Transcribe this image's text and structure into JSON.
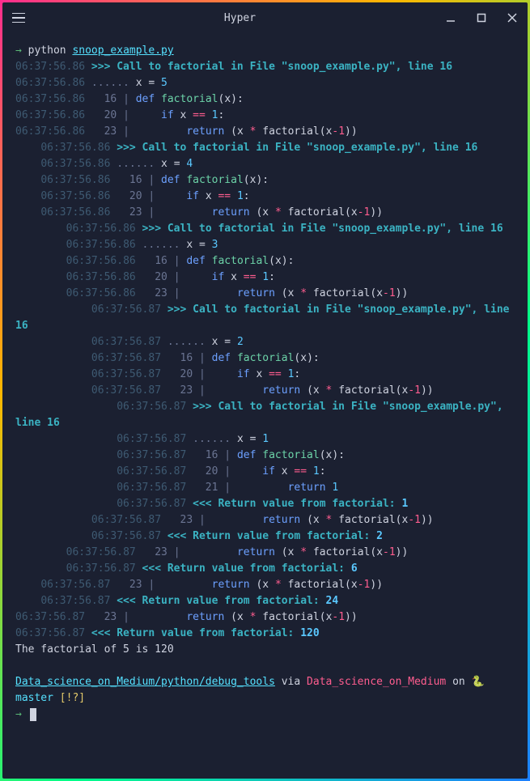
{
  "window": {
    "title": "Hyper"
  },
  "prompt": {
    "arrow": "→",
    "command": "python",
    "file": "snoop_example.py"
  },
  "trace": [
    {
      "indent": 0,
      "ts": "06:37:56.86",
      "kind": "call",
      "msg": "Call to factorial in File \"snoop_example.py\", line 16"
    },
    {
      "indent": 0,
      "ts": "06:37:56.86",
      "kind": "var",
      "name": "x",
      "val": "5"
    },
    {
      "indent": 0,
      "ts": "06:37:56.86",
      "kind": "def",
      "ln": "16"
    },
    {
      "indent": 0,
      "ts": "06:37:56.86",
      "kind": "if",
      "ln": "20"
    },
    {
      "indent": 0,
      "ts": "06:37:56.86",
      "kind": "retx",
      "ln": "23"
    },
    {
      "indent": 1,
      "ts": "06:37:56.86",
      "kind": "call",
      "msg": "Call to factorial in File \"snoop_example.py\", line 16"
    },
    {
      "indent": 1,
      "ts": "06:37:56.86",
      "kind": "var",
      "name": "x",
      "val": "4"
    },
    {
      "indent": 1,
      "ts": "06:37:56.86",
      "kind": "def",
      "ln": "16"
    },
    {
      "indent": 1,
      "ts": "06:37:56.86",
      "kind": "if",
      "ln": "20"
    },
    {
      "indent": 1,
      "ts": "06:37:56.86",
      "kind": "retx",
      "ln": "23"
    },
    {
      "indent": 2,
      "ts": "06:37:56.86",
      "kind": "call",
      "msg": "Call to factorial in File \"snoop_example.py\", line 16"
    },
    {
      "indent": 2,
      "ts": "06:37:56.86",
      "kind": "var",
      "name": "x",
      "val": "3"
    },
    {
      "indent": 2,
      "ts": "06:37:56.86",
      "kind": "def",
      "ln": "16"
    },
    {
      "indent": 2,
      "ts": "06:37:56.86",
      "kind": "if",
      "ln": "20"
    },
    {
      "indent": 2,
      "ts": "06:37:56.86",
      "kind": "retx",
      "ln": "23"
    },
    {
      "indent": 3,
      "ts": "06:37:56.87",
      "kind": "call",
      "msg": "Call to factorial in File \"snoop_example.py\", line 16"
    },
    {
      "indent": 3,
      "ts": "06:37:56.87",
      "kind": "var",
      "name": "x",
      "val": "2"
    },
    {
      "indent": 3,
      "ts": "06:37:56.87",
      "kind": "def",
      "ln": "16"
    },
    {
      "indent": 3,
      "ts": "06:37:56.87",
      "kind": "if",
      "ln": "20"
    },
    {
      "indent": 3,
      "ts": "06:37:56.87",
      "kind": "retx",
      "ln": "23"
    },
    {
      "indent": 4,
      "ts": "06:37:56.87",
      "kind": "call",
      "msg": "Call to factorial in File \"snoop_example.py\", line 16"
    },
    {
      "indent": 4,
      "ts": "06:37:56.87",
      "kind": "var",
      "name": "x",
      "val": "1"
    },
    {
      "indent": 4,
      "ts": "06:37:56.87",
      "kind": "def",
      "ln": "16"
    },
    {
      "indent": 4,
      "ts": "06:37:56.87",
      "kind": "if",
      "ln": "20"
    },
    {
      "indent": 4,
      "ts": "06:37:56.87",
      "kind": "ret1",
      "ln": "21"
    },
    {
      "indent": 4,
      "ts": "06:37:56.87",
      "kind": "retv",
      "val": "1"
    },
    {
      "indent": 3,
      "ts": "06:37:56.87",
      "kind": "retx",
      "ln": "23"
    },
    {
      "indent": 3,
      "ts": "06:37:56.87",
      "kind": "retv",
      "val": "2"
    },
    {
      "indent": 2,
      "ts": "06:37:56.87",
      "kind": "retx",
      "ln": "23"
    },
    {
      "indent": 2,
      "ts": "06:37:56.87",
      "kind": "retv",
      "val": "6"
    },
    {
      "indent": 1,
      "ts": "06:37:56.87",
      "kind": "retx",
      "ln": "23"
    },
    {
      "indent": 1,
      "ts": "06:37:56.87",
      "kind": "retv",
      "val": "24"
    },
    {
      "indent": 0,
      "ts": "06:37:56.87",
      "kind": "retx",
      "ln": "23"
    },
    {
      "indent": 0,
      "ts": "06:37:56.87",
      "kind": "retv",
      "val": "120"
    }
  ],
  "result": "The factorial of 5 is 120",
  "ps1": {
    "path": "Data_science_on_Medium/python/debug_tools",
    "via": "via",
    "env": "Data_science_on_Medium",
    "on": "on",
    "branch_icon": "🐍",
    "branch": "master",
    "dirty": "[!?]"
  },
  "code_tokens": {
    "def": "def",
    "factorial": "factorial",
    "if": "if",
    "return": "return",
    "eqeq": "==",
    "x": "x",
    "one": "1",
    "star": "*",
    "minus": "-"
  }
}
